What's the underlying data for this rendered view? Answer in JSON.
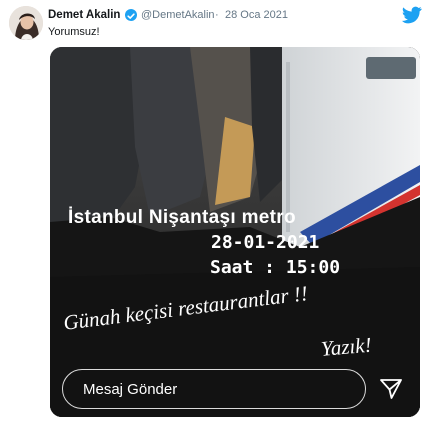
{
  "tweet": {
    "author_name": "Demet Akalin",
    "handle": "@DemetAkalin",
    "separator": "·",
    "date": "28 Oca 2021",
    "text": "Yorumsuz!"
  },
  "icons": {
    "verified": "verified-badge-icon",
    "brand": "twitter-bird-icon",
    "send": "send-icon"
  },
  "story": {
    "location_line": "İstanbul Nişantaşı metro",
    "date_line": "28-01-2021",
    "time_line": "Saat : 15:00",
    "caption_line1": "Günah keçisi restaurantlar !!",
    "caption_line2": "Yazık!",
    "message_placeholder": "Mesaj Gönder"
  },
  "colors": {
    "twitter_blue": "#1da1f2",
    "text_primary": "#14171a",
    "text_secondary": "#657786"
  }
}
